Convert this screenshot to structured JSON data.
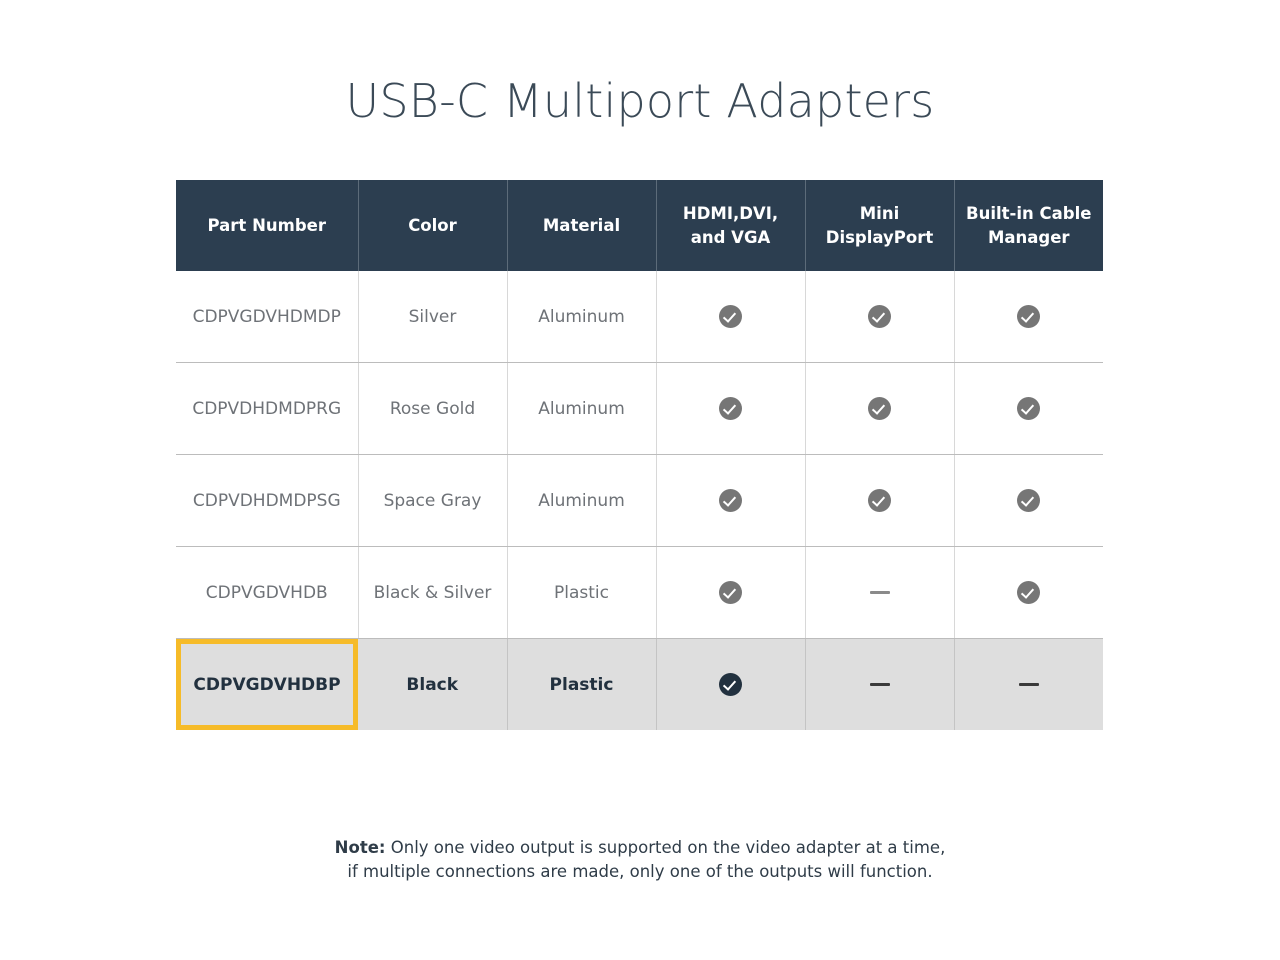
{
  "page": {
    "title": "USB-C Multiport Adapters",
    "background_color": "#ffffff"
  },
  "colors": {
    "header_background": "#2c3e50",
    "header_text": "#ffffff",
    "body_text": "#6e7277",
    "highlight_row_background": "#dedede",
    "highlight_border": "#f6bb28",
    "check_icon": "#767676",
    "check_icon_highlighted": "#22313f",
    "row_divider": "#bcbcbc"
  },
  "table": {
    "columns": [
      {
        "key": "part_number",
        "label": "Part Number"
      },
      {
        "key": "color",
        "label": "Color"
      },
      {
        "key": "material",
        "label": "Material"
      },
      {
        "key": "hdmi_dvi_vga",
        "label_line1": "HDMI,DVI,",
        "label_line2": "and VGA"
      },
      {
        "key": "mini_displayport",
        "label_line1": "Mini",
        "label_line2": "DisplayPort"
      },
      {
        "key": "built_in_cable_manager",
        "label_line1": "Built-in Cable",
        "label_line2": "Manager"
      }
    ],
    "rows": [
      {
        "part_number": "CDPVGDVHDMDP",
        "color": "Silver",
        "material": "Aluminum",
        "hdmi_dvi_vga": "yes",
        "mini_displayport": "yes",
        "built_in_cable_manager": "yes",
        "highlighted": false
      },
      {
        "part_number": "CDPVDHDMDPRG",
        "color": "Rose Gold",
        "material": "Aluminum",
        "hdmi_dvi_vga": "yes",
        "mini_displayport": "yes",
        "built_in_cable_manager": "yes",
        "highlighted": false
      },
      {
        "part_number": "CDPVDHDMDPSG",
        "color": "Space Gray",
        "material": "Aluminum",
        "hdmi_dvi_vga": "yes",
        "mini_displayport": "yes",
        "built_in_cable_manager": "yes",
        "highlighted": false
      },
      {
        "part_number": "CDPVGDVHDB",
        "color": "Black & Silver",
        "material": "Plastic",
        "hdmi_dvi_vga": "yes",
        "mini_displayport": "no",
        "built_in_cable_manager": "yes",
        "highlighted": false
      },
      {
        "part_number": "CDPVGDVHDBP",
        "color": "Black",
        "material": "Plastic",
        "hdmi_dvi_vga": "yes",
        "mini_displayport": "no",
        "built_in_cable_manager": "no",
        "highlighted": true
      }
    ]
  },
  "icons": {
    "yes": "check-circle-icon",
    "no": "dash-icon"
  },
  "note": {
    "label": "Note:",
    "line1": " Only one video output is supported on the video adapter at a time,",
    "line2": "if multiple connections are made, only one of the outputs will function."
  }
}
